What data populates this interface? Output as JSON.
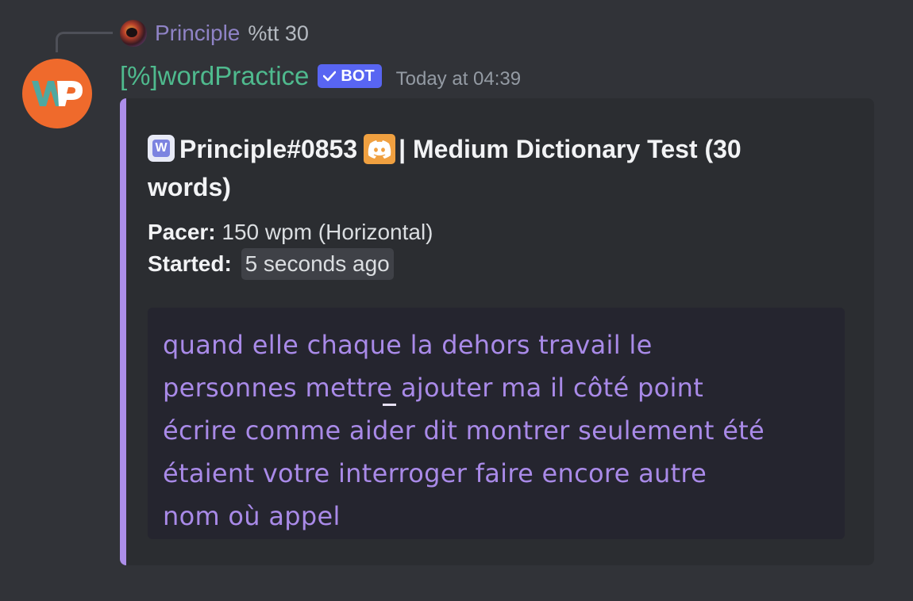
{
  "reply": {
    "author": "Principle",
    "content": "%tt 30"
  },
  "message": {
    "bot_name": "[%]wordPractice",
    "bot_tag": "BOT",
    "timestamp": "Today at 04:39",
    "avatar_letters": "WP"
  },
  "embed": {
    "accent_color": "#ac8ee9",
    "title_user": "Principle#0853",
    "title_rest": "| Medium Dictionary Test (30 words)",
    "pacer_label": "Pacer:",
    "pacer_value": "150 wpm (Horizontal)",
    "started_label": "Started:",
    "started_value": "5 seconds ago",
    "test_lines": [
      "quand elle chaque la dehors travail le",
      "personnes mettre ajouter ma il côté point",
      "écrire comme aider dit montrer seulement été",
      "étaient votre interroger faire encore autre",
      "nom où appel"
    ]
  },
  "icons": {
    "title_first_icon": "wordpractice-w-icon",
    "title_second_icon": "discord-icon",
    "verified": "checkmark-icon"
  }
}
